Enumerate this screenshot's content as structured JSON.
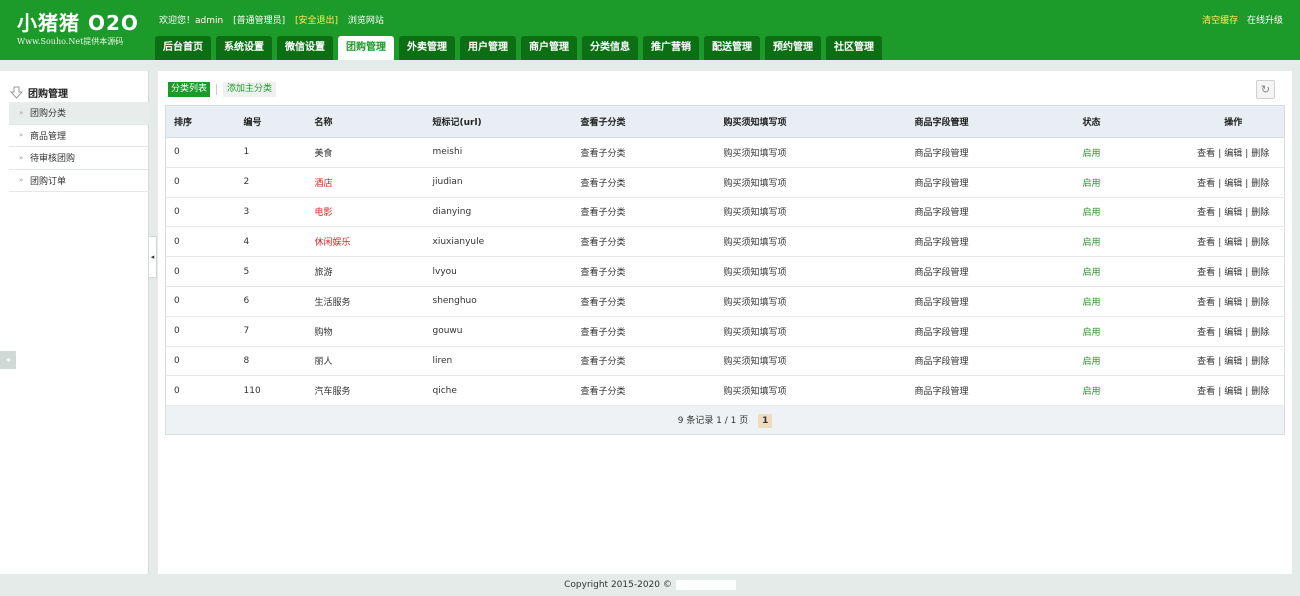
{
  "header": {
    "logo_title": "小猪猪 O2O",
    "logo_sub": "Www.Souho.Net提供本源码",
    "welcome": "欢迎您！admin",
    "role": "[普通管理员]",
    "logout": "[安全退出]",
    "browse": "浏览网站",
    "clear_cache": "清空缓存",
    "upgrade": "在线升级",
    "nav": [
      "后台首页",
      "系统设置",
      "微信设置",
      "团购管理",
      "外卖管理",
      "用户管理",
      "商户管理",
      "分类信息",
      "推广营销",
      "配送管理",
      "预约管理",
      "社区管理"
    ],
    "active_nav_index": 3
  },
  "sidebar": {
    "title": "团购管理",
    "items": [
      "团购分类",
      "商品管理",
      "待审核团购",
      "团购订单"
    ],
    "active_index": 0
  },
  "toolbar": {
    "list_label": "分类列表",
    "add_label": "添加主分类"
  },
  "table": {
    "columns": [
      "排序",
      "编号",
      "名称",
      "短标记(url)",
      "查看子分类",
      "购买须知填写项",
      "商品字段管理",
      "状态",
      "操作"
    ],
    "rows": [
      {
        "sort": "0",
        "id": "1",
        "name": "美食",
        "name_color": "#333333",
        "url": "meishi",
        "sub": "查看子分类",
        "notice": "购买须知填写项",
        "field": "商品字段管理",
        "status": "启用"
      },
      {
        "sort": "0",
        "id": "2",
        "name": "酒店",
        "name_color": "#e02020",
        "url": "jiudian",
        "sub": "查看子分类",
        "notice": "购买须知填写项",
        "field": "商品字段管理",
        "status": "启用"
      },
      {
        "sort": "0",
        "id": "3",
        "name": "电影",
        "name_color": "#e02020",
        "url": "dianying",
        "sub": "查看子分类",
        "notice": "购买须知填写项",
        "field": "商品字段管理",
        "status": "启用"
      },
      {
        "sort": "0",
        "id": "4",
        "name": "休闲娱乐",
        "name_color": "#e02020",
        "url": "xiuxianyule",
        "sub": "查看子分类",
        "notice": "购买须知填写项",
        "field": "商品字段管理",
        "status": "启用"
      },
      {
        "sort": "0",
        "id": "5",
        "name": "旅游",
        "name_color": "#333333",
        "url": "lvyou",
        "sub": "查看子分类",
        "notice": "购买须知填写项",
        "field": "商品字段管理",
        "status": "启用"
      },
      {
        "sort": "0",
        "id": "6",
        "name": "生活服务",
        "name_color": "#333333",
        "url": "shenghuo",
        "sub": "查看子分类",
        "notice": "购买须知填写项",
        "field": "商品字段管理",
        "status": "启用"
      },
      {
        "sort": "0",
        "id": "7",
        "name": "购物",
        "name_color": "#333333",
        "url": "gouwu",
        "sub": "查看子分类",
        "notice": "购买须知填写项",
        "field": "商品字段管理",
        "status": "启用"
      },
      {
        "sort": "0",
        "id": "8",
        "name": "丽人",
        "name_color": "#333333",
        "url": "liren",
        "sub": "查看子分类",
        "notice": "购买须知填写项",
        "field": "商品字段管理",
        "status": "启用"
      },
      {
        "sort": "0",
        "id": "110",
        "name": "汽车服务",
        "name_color": "#333333",
        "url": "qiche",
        "sub": "查看子分类",
        "notice": "购买须知填写项",
        "field": "商品字段管理",
        "status": "启用"
      }
    ],
    "actions": [
      "查看",
      "编辑",
      "删除"
    ],
    "pager_text": "9 条记录 1 / 1 页",
    "pager_current": "1"
  },
  "footer": {
    "copyright": "Copyright 2015-2020 ©"
  },
  "colors": {
    "brand": "#1c9a2a",
    "nav_tab": "#0c6f14",
    "red": "#e02020",
    "status": "#2a8f2a"
  }
}
